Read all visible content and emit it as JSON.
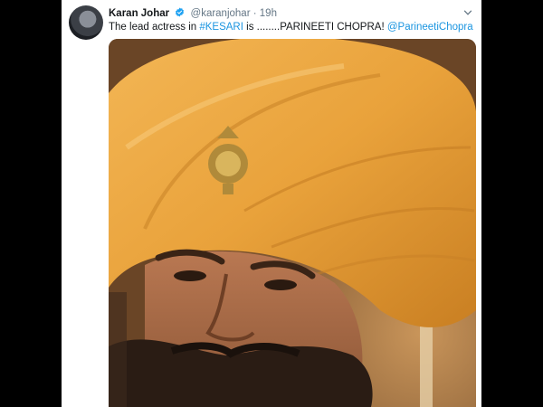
{
  "tweet": {
    "author_name": "Karan Johar",
    "handle": "@karanjohar",
    "separator": "·",
    "time": "19h",
    "text_before": "The lead actress in ",
    "hashtag": "#KESARI",
    "text_middle": " is ........PARINEETI CHOPRA! ",
    "mention": "@ParineetiChopra"
  },
  "colors": {
    "link": "#1b95e0",
    "verified": "#1da1f2",
    "turban": "#e9a23b"
  },
  "icons": {
    "verified": "verified-badge-icon",
    "menu": "chevron-down-icon"
  }
}
